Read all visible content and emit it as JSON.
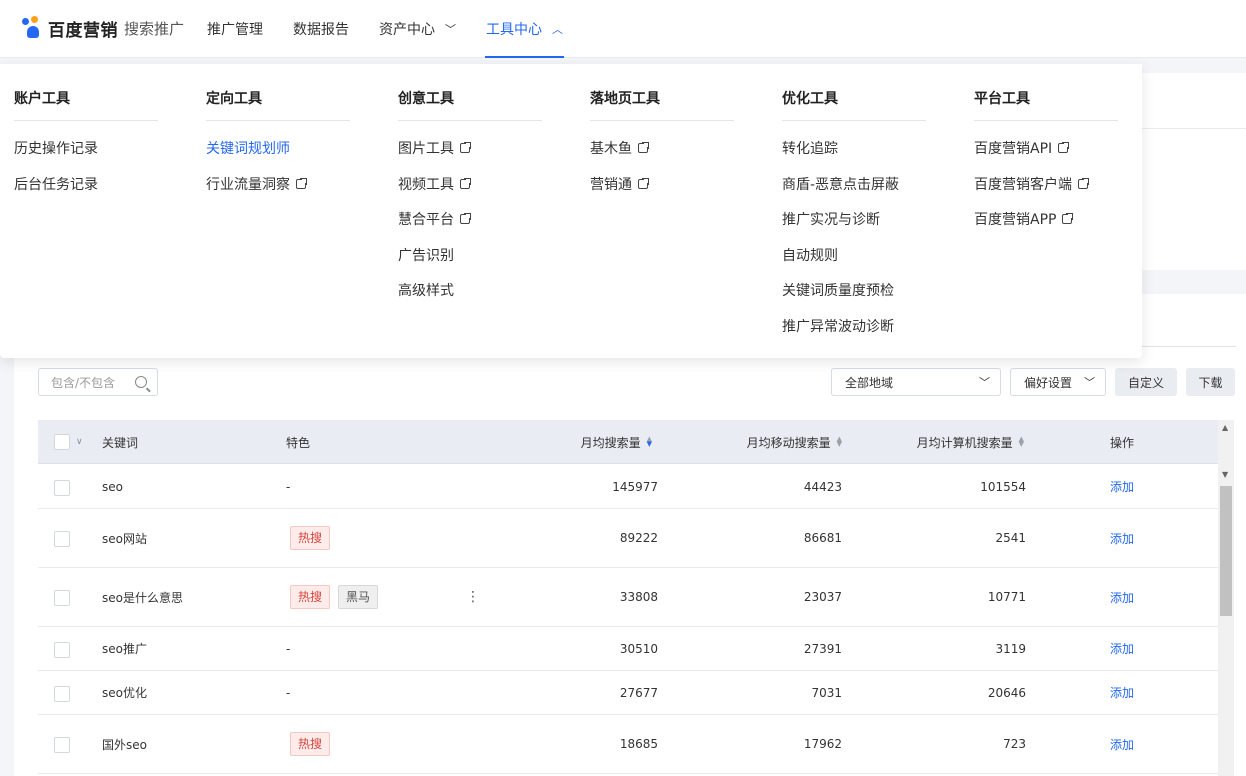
{
  "header": {
    "brand": "百度营销",
    "product": "搜索推广",
    "nav": [
      {
        "label": "推广管理",
        "has_dropdown": false,
        "active": false
      },
      {
        "label": "数据报告",
        "has_dropdown": false,
        "active": false
      },
      {
        "label": "资产中心",
        "has_dropdown": true,
        "active": false
      },
      {
        "label": "工具中心",
        "has_dropdown": true,
        "active": true
      }
    ]
  },
  "mega_menu": {
    "columns": [
      {
        "title": "账户工具",
        "items": [
          {
            "label": "历史操作记录",
            "external": false
          },
          {
            "label": "后台任务记录",
            "external": false
          }
        ]
      },
      {
        "title": "定向工具",
        "items": [
          {
            "label": "关键词规划师",
            "external": false,
            "active": true
          },
          {
            "label": "行业流量洞察",
            "external": true
          }
        ]
      },
      {
        "title": "创意工具",
        "items": [
          {
            "label": "图片工具",
            "external": true
          },
          {
            "label": "视频工具",
            "external": true
          },
          {
            "label": "慧合平台",
            "external": true
          },
          {
            "label": "广告识别",
            "external": false
          },
          {
            "label": "高级样式",
            "external": false
          }
        ]
      },
      {
        "title": "落地页工具",
        "items": [
          {
            "label": "基木鱼",
            "external": true
          },
          {
            "label": "营销通",
            "external": true
          }
        ]
      },
      {
        "title": "优化工具",
        "items": [
          {
            "label": "转化追踪",
            "external": false
          },
          {
            "label": "商盾-恶意点击屏蔽",
            "external": false
          },
          {
            "label": "推广实况与诊断",
            "external": false
          },
          {
            "label": "自动规则",
            "external": false
          },
          {
            "label": "关键词质量度预检",
            "external": false
          },
          {
            "label": "推广异常波动诊断",
            "external": false
          }
        ]
      },
      {
        "title": "平台工具",
        "items": [
          {
            "label": "百度营销API",
            "external": true
          },
          {
            "label": "百度营销客户端",
            "external": true
          },
          {
            "label": "百度营销APP",
            "external": true
          }
        ]
      }
    ]
  },
  "toolbar": {
    "filter_placeholder": "包含/不包含",
    "region_select": "全部地域",
    "preference_select": "偏好设置",
    "customize_label": "自定义",
    "download_label": "下载"
  },
  "table": {
    "columns": [
      "关键词",
      "特色",
      "月均搜索量",
      "月均移动搜索量",
      "月均计算机搜索量",
      "操作"
    ],
    "rows": [
      {
        "keyword": "seo",
        "tags": [],
        "feature_text": "-",
        "monthly": "145977",
        "mobile": "44423",
        "pc": "101554",
        "action": "添加"
      },
      {
        "keyword": "seo网站",
        "tags": [
          "热搜"
        ],
        "feature_text": "",
        "monthly": "89222",
        "mobile": "86681",
        "pc": "2541",
        "action": "添加"
      },
      {
        "keyword": "seo是什么意思",
        "tags": [
          "热搜",
          "黑马"
        ],
        "feature_text": "",
        "monthly": "33808",
        "mobile": "23037",
        "pc": "10771",
        "action": "添加"
      },
      {
        "keyword": "seo推广",
        "tags": [],
        "feature_text": "-",
        "monthly": "30510",
        "mobile": "27391",
        "pc": "3119",
        "action": "添加"
      },
      {
        "keyword": "seo优化",
        "tags": [],
        "feature_text": "-",
        "monthly": "27677",
        "mobile": "7031",
        "pc": "20646",
        "action": "添加"
      },
      {
        "keyword": "国外seo",
        "tags": [
          "热搜"
        ],
        "feature_text": "",
        "monthly": "18685",
        "mobile": "17962",
        "pc": "723",
        "action": "添加"
      }
    ]
  },
  "colors": {
    "accent": "#2468f2",
    "hot_tag": "#d6453d",
    "header_bg": "#e9ecf3"
  }
}
